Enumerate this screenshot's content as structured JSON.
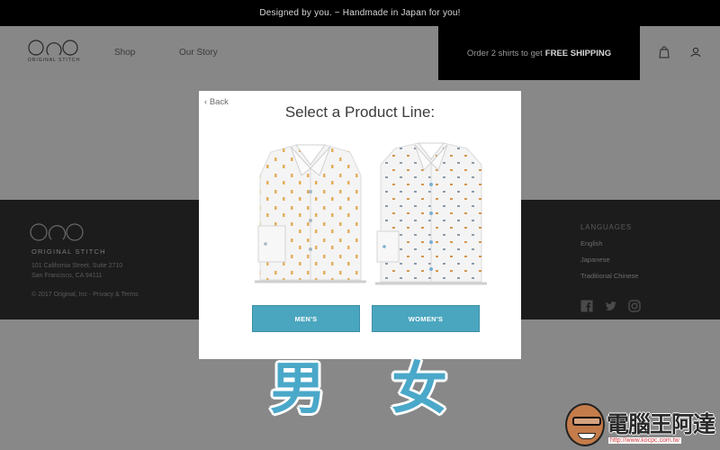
{
  "topbar": {
    "message": "Designed by you. ~ Handmade in Japan for you!"
  },
  "header": {
    "logo_text": "ORIGINAL STITCH",
    "nav": [
      {
        "label": "Shop"
      },
      {
        "label": "Our Story"
      }
    ],
    "shipping": {
      "prefix": "Order 2 shirts to get",
      "emphasis": "FREE SHIPPING"
    },
    "icons": [
      "bag-icon",
      "user-icon"
    ]
  },
  "footer": {
    "brand": "ORIGINAL STITCH",
    "address_line1": "101 California Street, Suite 2710",
    "address_line2": "San Francisco, CA 94111",
    "copyright": "© 2017 Original, Inc - Privacy & Terms",
    "languages_heading": "LANGUAGES",
    "languages": [
      {
        "label": "English"
      },
      {
        "label": "Japanese"
      },
      {
        "label": "Traditional Chinese"
      }
    ],
    "social": [
      "facebook-icon",
      "twitter-icon",
      "instagram-icon"
    ]
  },
  "modal": {
    "back_label": "Back",
    "title": "Select a Product Line:",
    "mens_button": "MEN'S",
    "womens_button": "WOMEN'S"
  },
  "overlay": {
    "men_char": "男",
    "women_char": "女"
  },
  "watermark": {
    "text": "電腦王阿達",
    "url": "http://www.kocpc.com.tw"
  },
  "colors": {
    "accent": "#4aa6bf",
    "overlay_char": "#4aa8c9",
    "dim_bg": "#888888"
  }
}
